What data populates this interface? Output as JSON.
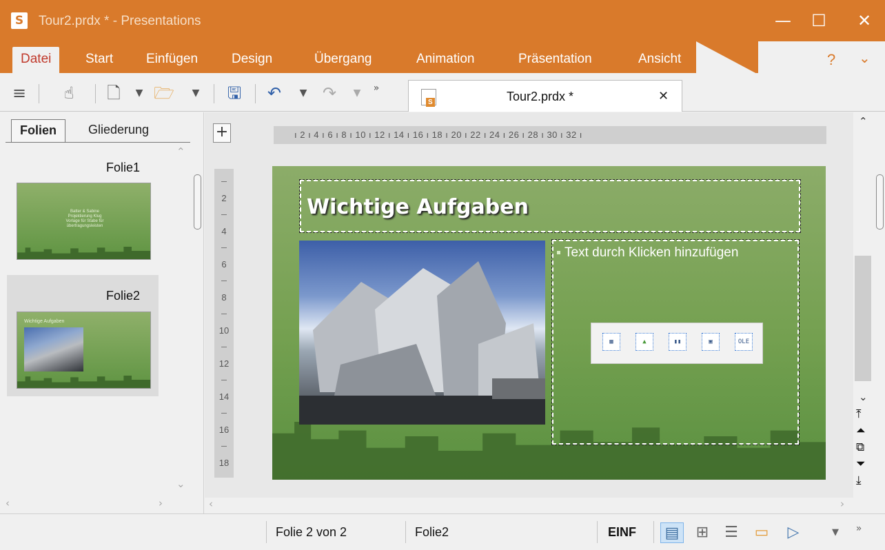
{
  "window": {
    "app_icon": "S",
    "title": "Tour2.prdx * - Presentations",
    "minimize": "—",
    "maximize": "☐",
    "close": "✕"
  },
  "menu": {
    "items": [
      "Datei",
      "Start",
      "Einfügen",
      "Design",
      "Übergang",
      "Animation",
      "Präsentation",
      "Ansicht"
    ],
    "active": "Datei",
    "help": "?",
    "collapse": "⌄"
  },
  "toolbar": {
    "icons": [
      "menu-icon",
      "hand-icon",
      "new-document-icon",
      "open-folder-icon",
      "save-icon",
      "undo-icon",
      "redo-icon",
      "more-icon"
    ],
    "more": "»"
  },
  "document_tab": {
    "title": "Tour2.prdx *",
    "close": "✕"
  },
  "left_pane": {
    "tabs": [
      "Folien",
      "Gliederung"
    ],
    "active_tab": "Folien",
    "slides": [
      {
        "label": "Folie1",
        "thumb_lines": [
          "Batter & Sabine",
          "Projektierung Klug",
          "Vorlage für Stabe für",
          "übertragungsleisten"
        ]
      },
      {
        "label": "Folie2",
        "thumb_title": "Wichtige Aufgaben"
      }
    ],
    "selected_slide": "Folie2"
  },
  "rulers": {
    "horizontal": "ı 2 ı 4 ı 6 ı 8 ı 10 ı 12 ı 14 ı 16 ı 18 ı 20 ı 22 ı 24 ı 26 ı 28 ı 30 ı 32 ı",
    "vertical": [
      "2",
      "4",
      "6",
      "8",
      "10",
      "12",
      "14",
      "16",
      "18"
    ]
  },
  "slide": {
    "title": "Wichtige Aufgaben",
    "content_placeholder": "Text durch Klicken hinzufügen",
    "insert_icons": [
      "table-icon",
      "picture-icon",
      "chart-icon",
      "media-icon",
      "ole-icon"
    ],
    "ole_label": "OLE"
  },
  "status": {
    "slide_position": "Folie 2 von 2",
    "slide_name": "Folie2",
    "mode": "EINF",
    "more": "»"
  },
  "colors": {
    "accent": "#d97a2b",
    "slide_green": "#74a050"
  }
}
